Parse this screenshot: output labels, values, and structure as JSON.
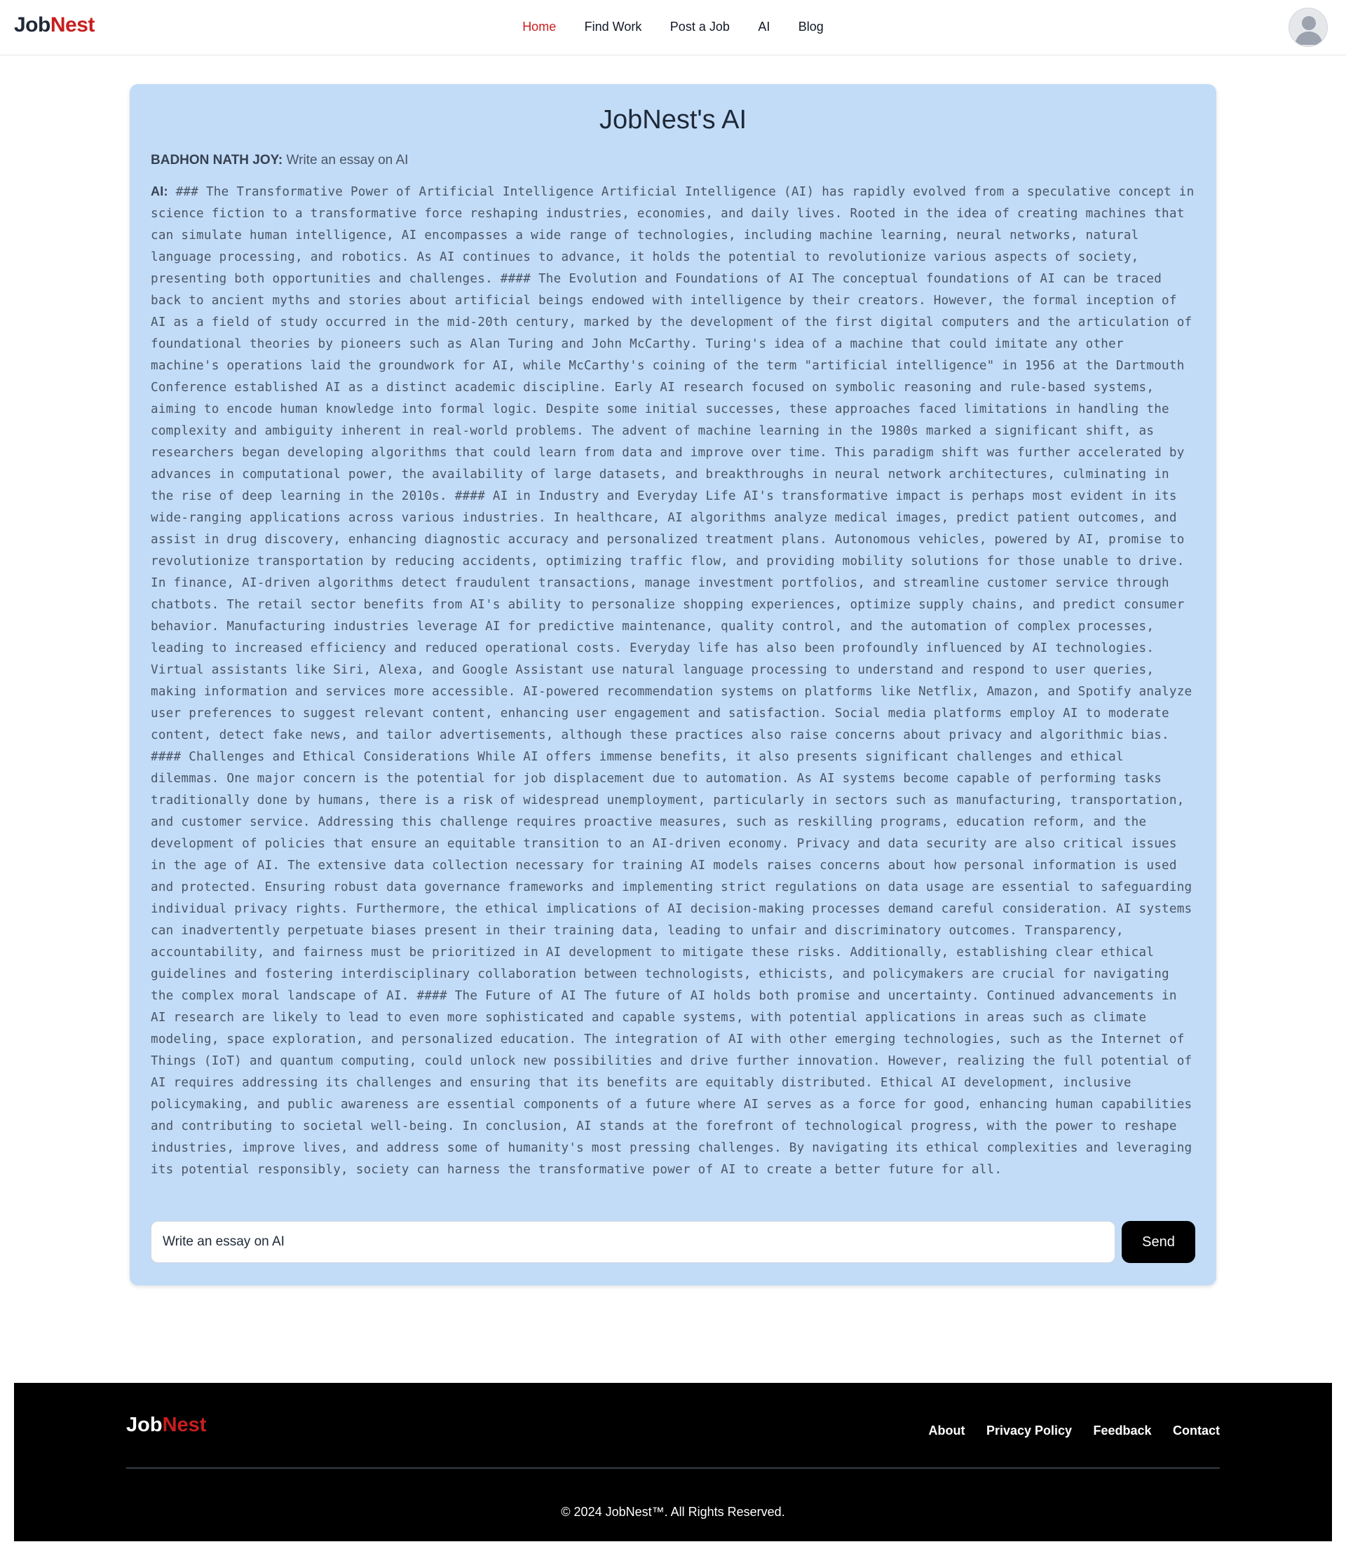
{
  "nav": {
    "brand_part1": "Job",
    "brand_part2": "Nest",
    "links": [
      "Home",
      "Find Work",
      "Post a Job",
      "AI",
      "Blog"
    ],
    "active": "Home",
    "avatar_icon": "user-avatar-icon"
  },
  "chat": {
    "title": "JobNest's AI",
    "user_name": "BADHON NATH JOY:",
    "user_message": "Write an essay on AI",
    "ai_label": "AI:",
    "ai_response": "### The Transformative Power of Artificial Intelligence Artificial Intelligence (AI) has rapidly evolved from a speculative concept in science fiction to a transformative force reshaping industries, economies, and daily lives. Rooted in the idea of creating machines that can simulate human intelligence, AI encompasses a wide range of technologies, including machine learning, neural networks, natural language processing, and robotics. As AI continues to advance, it holds the potential to revolutionize various aspects of society, presenting both opportunities and challenges. #### The Evolution and Foundations of AI The conceptual foundations of AI can be traced back to ancient myths and stories about artificial beings endowed with intelligence by their creators. However, the formal inception of AI as a field of study occurred in the mid-20th century, marked by the development of the first digital computers and the articulation of foundational theories by pioneers such as Alan Turing and John McCarthy. Turing's idea of a machine that could imitate any other machine's operations laid the groundwork for AI, while McCarthy's coining of the term \"artificial intelligence\" in 1956 at the Dartmouth Conference established AI as a distinct academic discipline. Early AI research focused on symbolic reasoning and rule-based systems, aiming to encode human knowledge into formal logic. Despite some initial successes, these approaches faced limitations in handling the complexity and ambiguity inherent in real-world problems. The advent of machine learning in the 1980s marked a significant shift, as researchers began developing algorithms that could learn from data and improve over time. This paradigm shift was further accelerated by advances in computational power, the availability of large datasets, and breakthroughs in neural network architectures, culminating in the rise of deep learning in the 2010s. #### AI in Industry and Everyday Life AI's transformative impact is perhaps most evident in its wide-ranging applications across various industries. In healthcare, AI algorithms analyze medical images, predict patient outcomes, and assist in drug discovery, enhancing diagnostic accuracy and personalized treatment plans. Autonomous vehicles, powered by AI, promise to revolutionize transportation by reducing accidents, optimizing traffic flow, and providing mobility solutions for those unable to drive. In finance, AI-driven algorithms detect fraudulent transactions, manage investment portfolios, and streamline customer service through chatbots. The retail sector benefits from AI's ability to personalize shopping experiences, optimize supply chains, and predict consumer behavior. Manufacturing industries leverage AI for predictive maintenance, quality control, and the automation of complex processes, leading to increased efficiency and reduced operational costs. Everyday life has also been profoundly influenced by AI technologies. Virtual assistants like Siri, Alexa, and Google Assistant use natural language processing to understand and respond to user queries, making information and services more accessible. AI-powered recommendation systems on platforms like Netflix, Amazon, and Spotify analyze user preferences to suggest relevant content, enhancing user engagement and satisfaction. Social media platforms employ AI to moderate content, detect fake news, and tailor advertisements, although these practices also raise concerns about privacy and algorithmic bias. #### Challenges and Ethical Considerations While AI offers immense benefits, it also presents significant challenges and ethical dilemmas. One major concern is the potential for job displacement due to automation. As AI systems become capable of performing tasks traditionally done by humans, there is a risk of widespread unemployment, particularly in sectors such as manufacturing, transportation, and customer service. Addressing this challenge requires proactive measures, such as reskilling programs, education reform, and the development of policies that ensure an equitable transition to an AI-driven economy. Privacy and data security are also critical issues in the age of AI. The extensive data collection necessary for training AI models raises concerns about how personal information is used and protected. Ensuring robust data governance frameworks and implementing strict regulations on data usage are essential to safeguarding individual privacy rights. Furthermore, the ethical implications of AI decision-making processes demand careful consideration. AI systems can inadvertently perpetuate biases present in their training data, leading to unfair and discriminatory outcomes. Transparency, accountability, and fairness must be prioritized in AI development to mitigate these risks. Additionally, establishing clear ethical guidelines and fostering interdisciplinary collaboration between technologists, ethicists, and policymakers are crucial for navigating the complex moral landscape of AI. #### The Future of AI The future of AI holds both promise and uncertainty. Continued advancements in AI research are likely to lead to even more sophisticated and capable systems, with potential applications in areas such as climate modeling, space exploration, and personalized education. The integration of AI with other emerging technologies, such as the Internet of Things (IoT) and quantum computing, could unlock new possibilities and drive further innovation. However, realizing the full potential of AI requires addressing its challenges and ensuring that its benefits are equitably distributed. Ethical AI development, inclusive policymaking, and public awareness are essential components of a future where AI serves as a force for good, enhancing human capabilities and contributing to societal well-being. In conclusion, AI stands at the forefront of technological progress, with the power to reshape industries, improve lives, and address some of humanity's most pressing challenges. By navigating its ethical complexities and leveraging its potential responsibly, society can harness the transformative power of AI to create a better future for all.",
    "input_value": "Write an essay on AI",
    "send_label": "Send"
  },
  "footer": {
    "brand_part1": "Job",
    "brand_part2": "Nest",
    "links": [
      "About",
      "Privacy Policy",
      "Feedback",
      "Contact"
    ],
    "copyright": "© 2024 JobNest™. All Rights Reserved."
  },
  "colors": {
    "brand_red": "#c81e1e",
    "chat_background": "#c2dcf8",
    "button_black": "#000000",
    "footer_black": "#000000"
  }
}
